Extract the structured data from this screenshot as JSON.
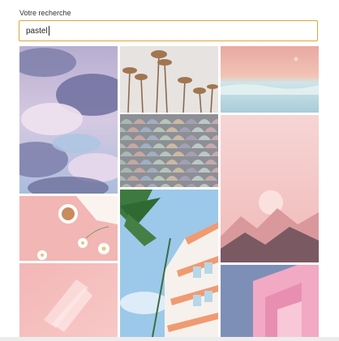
{
  "search": {
    "label": "Votre recherche",
    "value": "pastel"
  },
  "results": {
    "columns": [
      {
        "tiles": [
          {
            "subject": "pastel cloudy sky",
            "icon": "clouds-photo"
          },
          {
            "subject": "pink flatlay with coffee and flowers",
            "icon": "coffee-flowers-photo"
          },
          {
            "subject": "pink painted texture",
            "icon": "pink-texture-photo"
          }
        ]
      },
      {
        "tiles": [
          {
            "subject": "palm trees against pale sky",
            "icon": "palm-trees-photo"
          },
          {
            "subject": "pastel scale tiles",
            "icon": "tiles-photo"
          },
          {
            "subject": "pastel building with palm",
            "icon": "building-palm-photo"
          }
        ]
      },
      {
        "tiles": [
          {
            "subject": "pastel sea and sky",
            "icon": "sea-sky-photo"
          },
          {
            "subject": "pink mountains with moon",
            "icon": "mountains-moon-photo"
          },
          {
            "subject": "pink architecture",
            "icon": "pink-architecture-photo"
          }
        ]
      }
    ]
  },
  "colors": {
    "input_border": "#e0a43a",
    "background": "#ffffff"
  }
}
